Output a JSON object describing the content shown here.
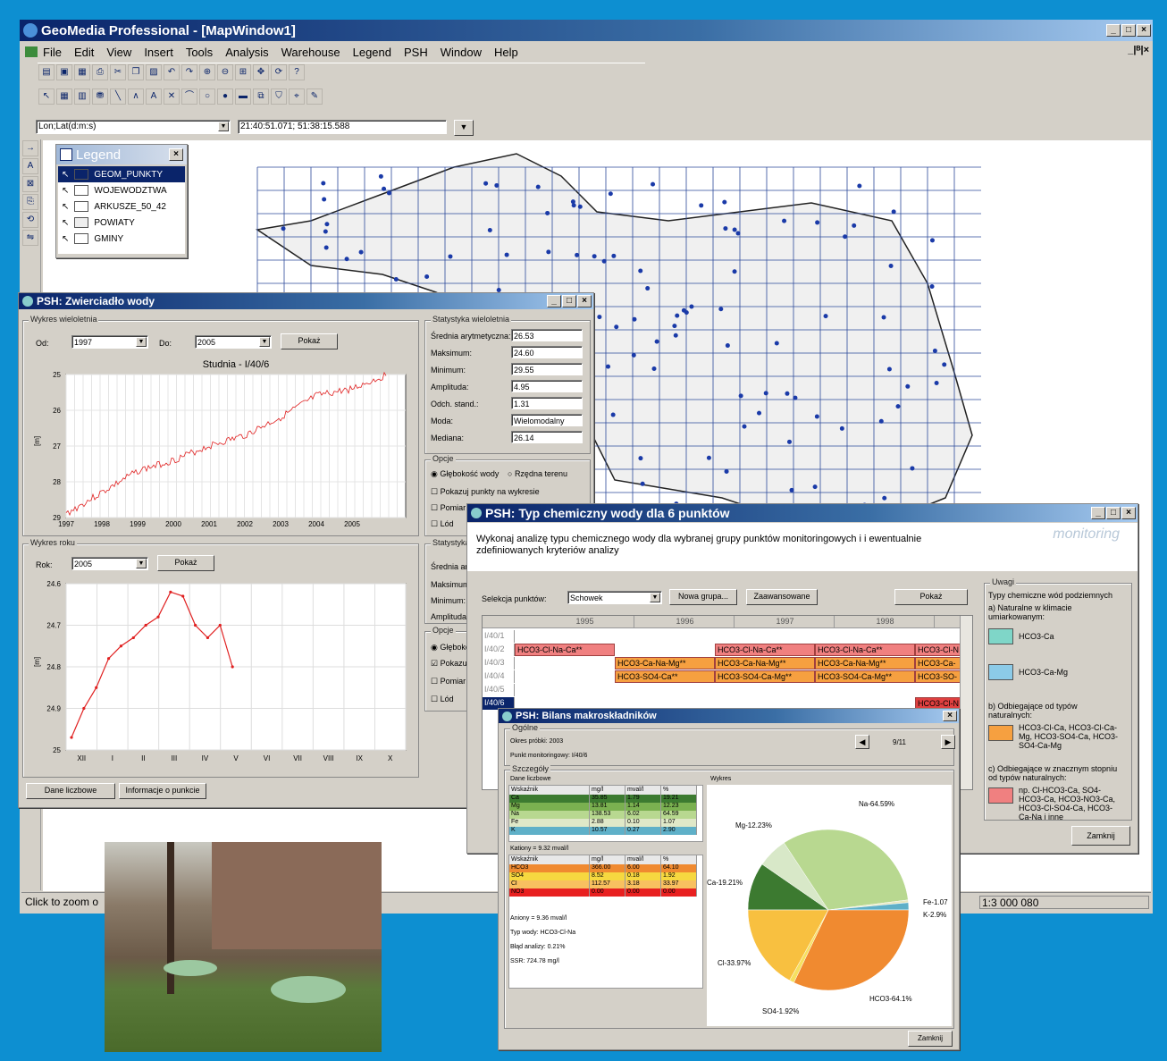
{
  "app": {
    "title": "GeoMedia Professional - [MapWindow1]",
    "menu": [
      "File",
      "Edit",
      "View",
      "Insert",
      "Tools",
      "Analysis",
      "Warehouse",
      "Legend",
      "PSH",
      "Window",
      "Help"
    ],
    "coord_system": "Lon;Lat(d:m:s)",
    "coord_value": "21:40:51.071; 51:38:15.588",
    "status": "Click to zoom o",
    "scale": "1:3 000 080"
  },
  "legend": {
    "title": "Legend",
    "items": [
      "GEOM_PUNKTY",
      "WOJEWODZTWA",
      "ARKUSZE_50_42",
      "POWIATY",
      "GMINY"
    ]
  },
  "zw": {
    "title": "PSH: Zwierciadło wody",
    "group1": "Wykres wieloletnia",
    "od_label": "Od:",
    "od": "1997",
    "do_label": "Do:",
    "do": "2005",
    "show": "Pokaż",
    "chart1_title": "Studnia - I/40/6",
    "chart1_ylabel": "[m]",
    "chart1_yticks": [
      "25",
      "26",
      "27",
      "28",
      "29"
    ],
    "chart1_xticks": [
      "1997",
      "1998",
      "1999",
      "2000",
      "2001",
      "2002",
      "2003",
      "2004",
      "2005"
    ],
    "group2": "Wykres roku",
    "rok_label": "Rok:",
    "rok": "2005",
    "show2": "Pokaż",
    "chart2_yticks": [
      "24.6",
      "24.7",
      "24.8",
      "24.9",
      "25"
    ],
    "chart2_xticks": [
      "XII",
      "I",
      "II",
      "III",
      "IV",
      "V",
      "VI",
      "VII",
      "VIII",
      "IX",
      "X"
    ],
    "stats_title": "Statystyka wieloletnia",
    "stats": [
      {
        "l": "Średnia arytmetyczna:",
        "v": "26.53"
      },
      {
        "l": "Maksimum:",
        "v": "24.60"
      },
      {
        "l": "Minimum:",
        "v": "29.55"
      },
      {
        "l": "Amplituda:",
        "v": "4.95"
      },
      {
        "l": "Odch. stand.:",
        "v": "1.31"
      },
      {
        "l": "Moda:",
        "v": "Wielomodalny"
      },
      {
        "l": "Mediana:",
        "v": "26.14"
      }
    ],
    "opcje": "Opcje",
    "opt_r1": "Głębokość wody",
    "opt_r2": "Rzędna terenu",
    "opt_c1": "Pokazuj punkty na wykresie",
    "opt_c2": "Pomiar",
    "opt_c3": "Lód",
    "stats2_title": "Statystyka",
    "stats2": [
      "Średnia ary",
      "Maksimum:",
      "Minimum:",
      "Amplituda:"
    ],
    "opcje2": "Opcje",
    "opt2_r1": "Głęboko",
    "opt2_c1": "Pokazu",
    "opt2_c2": "Pomiar",
    "opt2_c3": "Lód",
    "btn_dane": "Dane liczbowe",
    "btn_info": "Informacje o punkcie"
  },
  "typ": {
    "title": "PSH: Typ chemiczny wody dla 6 punktów",
    "desc": "Wykonaj analizę typu chemicznego wody dla wybranej grupy punktów monitoringowych i i ewentualnie zdefiniowanych kryteriów analizy",
    "brand": "monitoring",
    "sel_label": "Selekcja punktów:",
    "sel": "Schowek",
    "btn_new": "Nowa grupa...",
    "btn_adv": "Zaawansowane",
    "btn_show": "Pokaż",
    "years": [
      "1995",
      "1996",
      "1997",
      "1998",
      "19"
    ],
    "rows": [
      "I/40/1",
      "I/40/2",
      "I/40/3",
      "I/40/4",
      "I/40/5",
      "I/40/6"
    ],
    "c_a": "HCO3-Cl-Na-Ca**",
    "c_b": "HCO3-Ca-Na-Mg**",
    "c_c": "HCO3-SO4-Ca**",
    "c_d": "HCO3-SO4-Ca-Mg**",
    "c_e": "HCO3-Ca-Na-Mg**",
    "c_f": "HCO3-Cl-N",
    "c_g": "HCO3-Ca-",
    "c_h": "HCO3-SO-",
    "c_i": "HCO3-Cl-N",
    "uwagi": "Uwagi",
    "u1": "Typy chemiczne wód podziemnych",
    "u2": "a) Naturalne w klimacie umiarkowanym:",
    "u3": "HCO3-Ca",
    "u4": "HCO3-Ca-Mg",
    "u5": "b) Odbiegające od typów naturalnych:",
    "u6": "HCO3-Cl-Ca, HCO3-Cl-Ca-Mg, HCO3-SO4-Ca, HCO3-SO4-Ca-Mg",
    "u7": "c) Odbiegające w znacznym stopniu od typów naturalnych:",
    "u8": "np. Cl-HCO3-Ca, SO4-HCO3-Ca, HCO3-NO3-Ca, HCO3-Cl-SO4-Ca, HCO3-Ca-Na i inne",
    "btn_close": "Zamknij"
  },
  "bil": {
    "title": "PSH: Bilans makroskładników",
    "og": "Ogólne",
    "okres": "Okres próbki: 2003",
    "punkt": "Punkt monitoringowy: I/40/6",
    "nav": "9/11",
    "szcz": "Szczegóły",
    "dane": "Dane liczbowe",
    "wykres": "Wykres",
    "hdr": [
      "Wskaźnik",
      "mg/l",
      "mval/l",
      "%"
    ],
    "kat": [
      [
        "Ca",
        "35.85",
        "1.79",
        "19.21"
      ],
      [
        "Mg",
        "13.81",
        "1.14",
        "12.23"
      ],
      [
        "Na",
        "138.53",
        "6.02",
        "64.59"
      ],
      [
        "Fe",
        "2.88",
        "0.10",
        "1.07"
      ],
      [
        "K",
        "10.57",
        "0.27",
        "2.90"
      ]
    ],
    "kat_sum": "Kationy = 9.32 mval/l",
    "an": [
      [
        "HCO3",
        "366.00",
        "6.00",
        "64.10"
      ],
      [
        "SO4",
        "8.52",
        "0.18",
        "1.92"
      ],
      [
        "Cl",
        "112.57",
        "3.18",
        "33.97"
      ],
      [
        "NO3",
        "0.00",
        "0.00",
        "0.00"
      ]
    ],
    "an_sum": "Aniony = 9.36 mval/l",
    "typ": "Typ wody: HCO3-Cl-Na",
    "blad": "Błąd analizy: 0.21%",
    "ssr": "SSR: 724.78 mg/l",
    "btn_close": "Zamknij"
  },
  "chart_data": [
    {
      "type": "pie",
      "title": "",
      "slices": [
        {
          "label": "Na-64.59%",
          "value": 64.59
        },
        {
          "label": "Fe-1.07%",
          "value": 1.07
        },
        {
          "label": "K-2.9%",
          "value": 2.9
        },
        {
          "label": "Ca-19.21%",
          "value": 19.21
        },
        {
          "label": "Mg-12.23%",
          "value": 12.23
        }
      ],
      "visible_labels": [
        "Na-64.59%",
        "Mg-12.23%",
        "Ca-19.21%",
        "Fe-1.07",
        "K-2.9%"
      ]
    },
    {
      "type": "pie",
      "title": "",
      "slices": [
        {
          "label": "HCO3-64.1%",
          "value": 64.1
        },
        {
          "label": "Cl-33.97%",
          "value": 33.97
        },
        {
          "label": "SO4-1.92%",
          "value": 1.92
        }
      ]
    },
    {
      "type": "line",
      "title": "Studnia - I/40/6",
      "ylabel": "[m]",
      "x": [
        1997,
        1998,
        1999,
        2000,
        2001,
        2002,
        2003,
        2004,
        2005,
        2006
      ],
      "y": [
        28.9,
        28.3,
        27.7,
        27.4,
        27.0,
        26.7,
        26.2,
        25.6,
        25.4,
        25.0
      ],
      "ylim": [
        25,
        29
      ],
      "inverted": true
    },
    {
      "type": "line",
      "title": "",
      "ylabel": "[m]",
      "categories": [
        "XII",
        "I",
        "II",
        "III",
        "IV",
        "V"
      ],
      "y": [
        24.97,
        24.9,
        24.85,
        24.78,
        24.75,
        24.73,
        24.7,
        24.68,
        24.62,
        24.63,
        24.7,
        24.73,
        24.7,
        24.8
      ],
      "ylim": [
        24.6,
        25
      ],
      "inverted": true
    }
  ]
}
